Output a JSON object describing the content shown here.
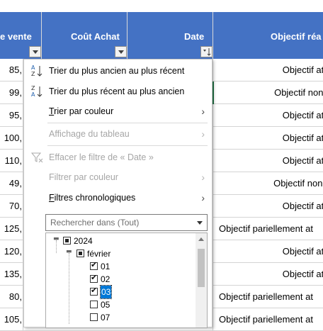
{
  "headers": {
    "col1": "e vente",
    "col2": "Coût Achat",
    "col3": "Date",
    "col4": "Objectif réa"
  },
  "rows": [
    {
      "value": "85,",
      "objective": "Objectif at"
    },
    {
      "value": "99,",
      "objective": "Objectif non at"
    },
    {
      "value": "95,",
      "objective": "Objectif at"
    },
    {
      "value": "100,",
      "objective": "Objectif at"
    },
    {
      "value": "110,",
      "objective": "Objectif at"
    },
    {
      "value": "49,",
      "objective": "Objectif non at"
    },
    {
      "value": "70,",
      "objective": "Objectif at"
    },
    {
      "value": "125,",
      "objective": "Objectif pariellement at"
    },
    {
      "value": "120,",
      "objective": "Objectif at"
    },
    {
      "value": "135,",
      "objective": "Objectif at"
    },
    {
      "value": "80,",
      "objective": "Objectif pariellement at"
    },
    {
      "value": "105,",
      "objective": "Objectif pariellement at"
    }
  ],
  "menu": {
    "sort_asc": "Trier du plus ancien au plus récent",
    "sort_desc": "Trier du plus récent au plus ancien",
    "sort_color": "Trier par couleur",
    "sheet_view": "Affichage du tableau",
    "clear_filter": "Effacer le filtre de « Date »",
    "filter_color": "Filtrer par couleur",
    "date_filters": "Filtres chronologiques",
    "search_placeholder": "Rechercher dans (Tout)"
  },
  "tree": {
    "year": "2024",
    "month": "février",
    "days": [
      {
        "label": "01",
        "checked": true
      },
      {
        "label": "02",
        "checked": true
      },
      {
        "label": "03",
        "checked": true,
        "selected": true
      },
      {
        "label": "05",
        "checked": false
      },
      {
        "label": "07",
        "checked": false
      }
    ]
  },
  "colors": {
    "header_bg": "#4472c4",
    "selection": "#0078d7"
  }
}
